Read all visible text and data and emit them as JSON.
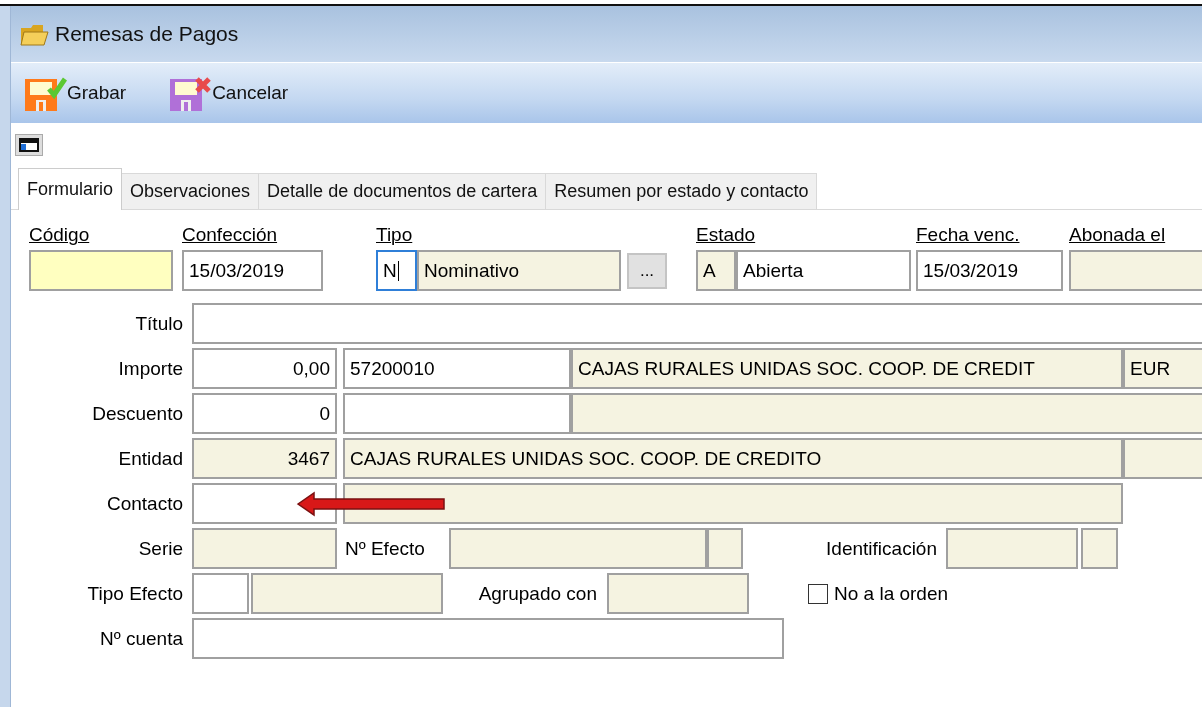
{
  "window": {
    "title": "Remesas de Pagos"
  },
  "toolbar": [
    {
      "label": "Grabar",
      "kind": "save"
    },
    {
      "label": "Cancelar",
      "kind": "cancel"
    }
  ],
  "tabs": [
    {
      "label": "Formulario",
      "selected": true
    },
    {
      "label": "Observaciones",
      "selected": false
    },
    {
      "label": "Detalle de documentos de cartera",
      "selected": false
    },
    {
      "label": "Resumen por estado y contacto",
      "selected": false
    }
  ],
  "header": [
    {
      "label": "Código",
      "boxes": [
        {
          "kind": "required"
        }
      ]
    },
    {
      "label": "Confección",
      "boxes": [
        {
          "kind": "editable",
          "value": "15/03/2019"
        }
      ]
    },
    {
      "label": "Tipo",
      "boxes": [
        {
          "kind": "focused",
          "value": "N"
        },
        {
          "kind": "readonly",
          "value": "Nominativo"
        },
        {
          "kind": "button",
          "value": "..."
        }
      ]
    },
    {
      "label": "Estado",
      "boxes": [
        {
          "kind": "readonly",
          "value": "A"
        },
        {
          "kind": "editable",
          "value": "Abierta"
        }
      ]
    },
    {
      "label": "Fecha venc.",
      "boxes": [
        {
          "kind": "editable",
          "value": "15/03/2019"
        }
      ]
    },
    {
      "label": "Abonada el",
      "boxes": [
        {
          "kind": "readonly"
        }
      ]
    }
  ],
  "rows": [
    {
      "label": "Título",
      "items": [
        {
          "kind": "editable"
        }
      ]
    },
    {
      "label": "Importe",
      "items": [
        {
          "kind": "editable",
          "value": "0,00"
        },
        {
          "kind": "editable",
          "value": "57200010"
        },
        {
          "kind": "readonly",
          "value": "CAJAS RURALES UNIDAS SOC. COOP. DE CREDIT"
        },
        {
          "kind": "readonly",
          "value": "EUR"
        }
      ]
    },
    {
      "label": "Descuento",
      "items": [
        {
          "kind": "editable",
          "value": "0"
        },
        {
          "kind": "editable"
        },
        {
          "kind": "readonly"
        }
      ]
    },
    {
      "label": "Entidad",
      "items": [
        {
          "kind": "readonly",
          "value": "3467"
        },
        {
          "kind": "readonly",
          "value": "CAJAS RURALES UNIDAS SOC. COOP. DE CREDITO"
        },
        {
          "kind": "readonly"
        }
      ]
    },
    {
      "label": "Contacto",
      "items": [
        {
          "kind": "editable"
        },
        {
          "kind": "readonly"
        }
      ]
    },
    {
      "label": "Serie",
      "items": [
        {
          "kind": "readonly"
        },
        {
          "kind": "label",
          "value": "Nº Efecto"
        },
        {
          "kind": "readonly"
        },
        {
          "kind": "readonly"
        },
        {
          "kind": "label",
          "value": "Identificación"
        },
        {
          "kind": "readonly"
        },
        {
          "kind": "readonly"
        }
      ]
    },
    {
      "label": "Tipo Efecto",
      "items": [
        {
          "kind": "editable"
        },
        {
          "kind": "readonly"
        },
        {
          "kind": "label",
          "value": "Agrupado con"
        },
        {
          "kind": "readonly"
        },
        {
          "kind": "checkbox",
          "value": "No a la orden",
          "checked": false
        }
      ]
    },
    {
      "label": "Nº cuenta",
      "items": [
        {
          "kind": "editable"
        }
      ]
    }
  ]
}
